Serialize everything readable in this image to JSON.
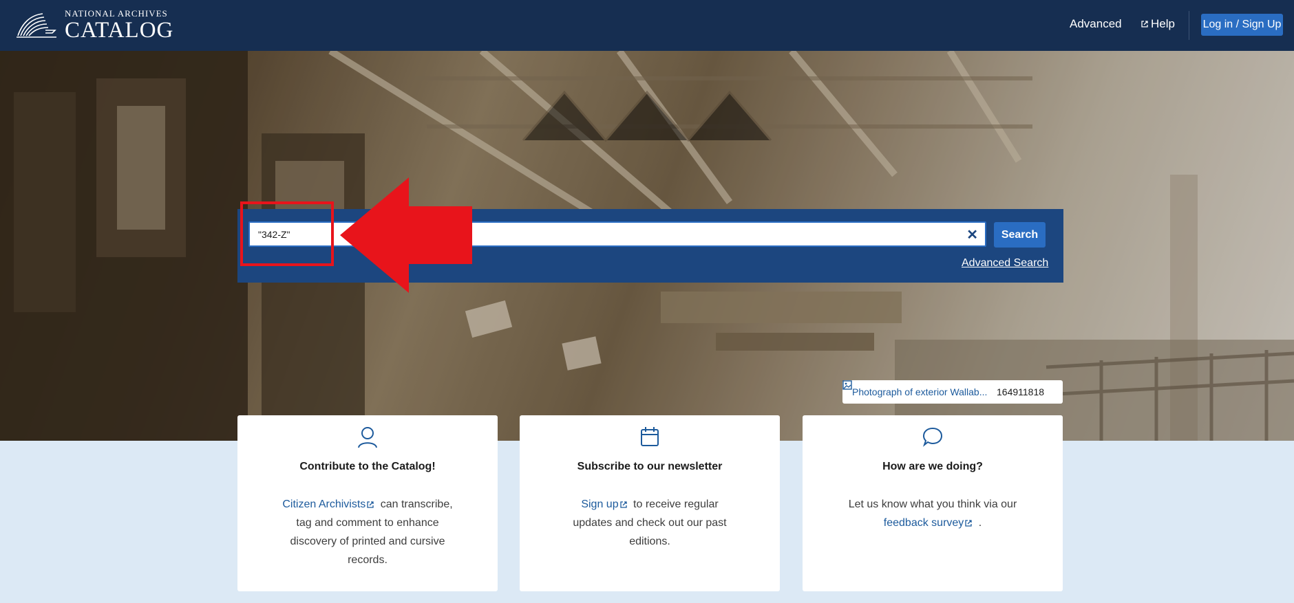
{
  "header": {
    "logo_small": "NATIONAL ARCHIVES",
    "logo_big": "CATALOG",
    "nav_advanced": "Advanced",
    "nav_help": "Help",
    "login": "Log in / Sign Up"
  },
  "search": {
    "value": "\"342-Z\"",
    "button": "Search",
    "advanced_link": "Advanced Search"
  },
  "caption": {
    "title": "Photograph of exterior Wallab...",
    "id": "164911818"
  },
  "cards": [
    {
      "title": "Contribute to the Catalog!",
      "link": "Citizen Archivists",
      "text": "can transcribe, tag and comment to enhance discovery of printed and cursive records."
    },
    {
      "title": "Subscribe to our newsletter",
      "link": "Sign up",
      "text": "to receive regular updates and check out our past editions."
    },
    {
      "title": "How are we doing?",
      "prefix": "Let us know what you think via our",
      "link": "feedback survey",
      "text": "."
    }
  ],
  "colors": {
    "header_bg": "#162e51",
    "search_panel": "#1c467f",
    "button": "#2a6dc2",
    "annotation": "#e8141b",
    "page_bg": "#dce9f5"
  }
}
